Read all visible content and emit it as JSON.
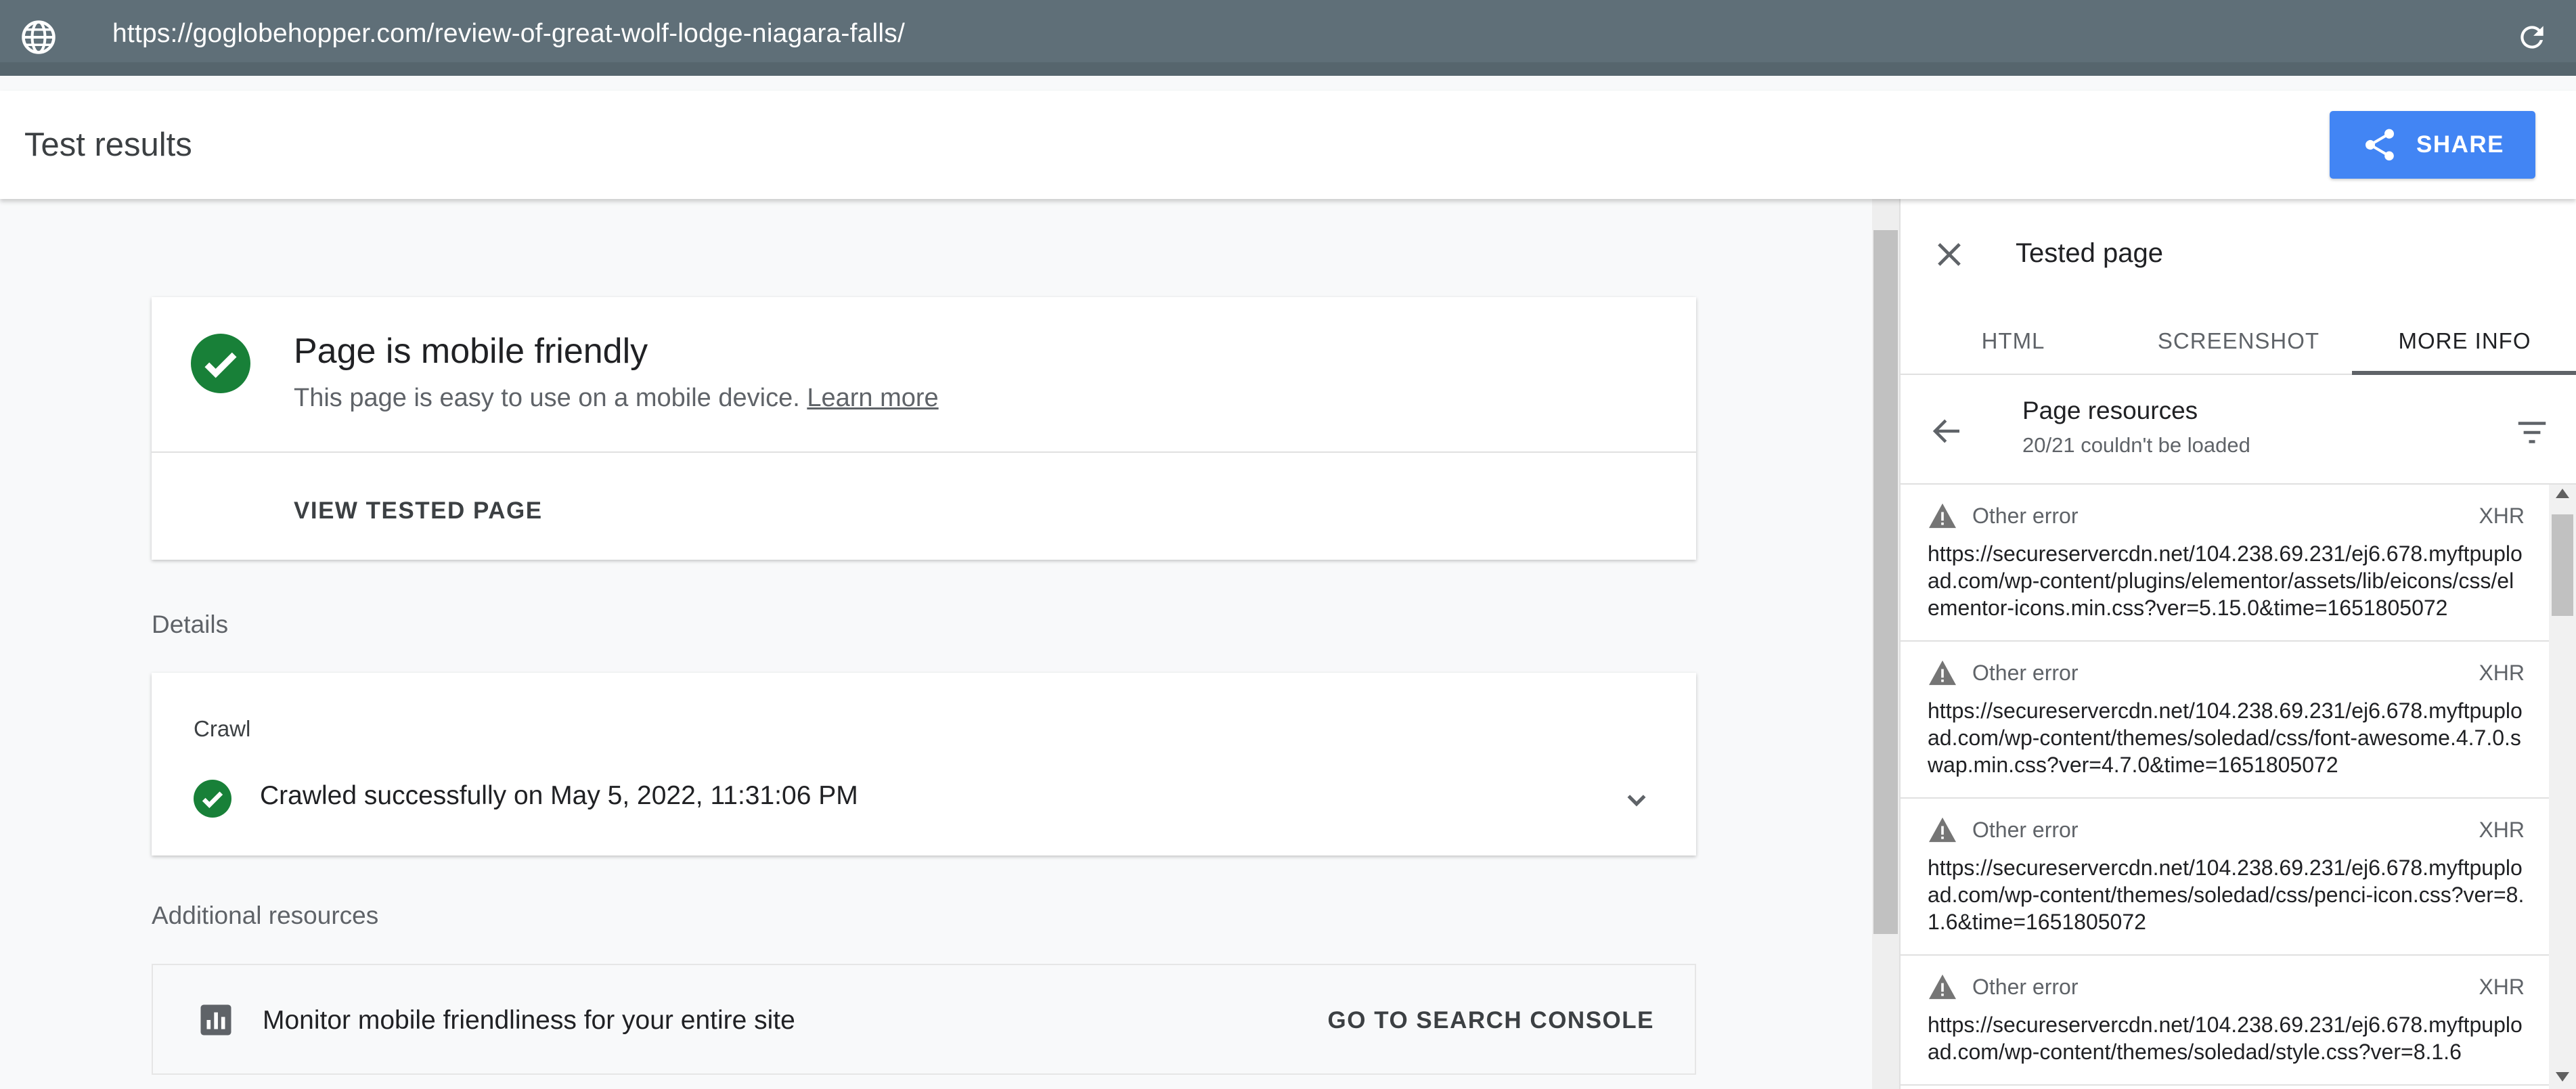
{
  "browser": {
    "url": "https://goglobehopper.com/review-of-great-wolf-lodge-niagara-falls/"
  },
  "header": {
    "title": "Test results",
    "share_label": "SHARE"
  },
  "result": {
    "heading": "Page is mobile friendly",
    "description": "This page is easy to use on a mobile device.",
    "learn_more": "Learn more",
    "view_tested_page": "VIEW TESTED PAGE"
  },
  "details": {
    "label": "Details",
    "crawl_label": "Crawl",
    "crawl_status": "Crawled successfully on May 5, 2022, 11:31:06 PM"
  },
  "additional": {
    "label": "Additional resources",
    "monitor_text": "Monitor mobile friendliness for your entire site",
    "console_button": "GO TO SEARCH CONSOLE"
  },
  "panel": {
    "title": "Tested page",
    "tabs": [
      "HTML",
      "SCREENSHOT",
      "MORE INFO"
    ],
    "active_tab": "MORE INFO",
    "resources_title": "Page resources",
    "resources_subtitle": "20/21 couldn't be loaded",
    "resources": [
      {
        "error": "Other error",
        "type": "XHR",
        "url": "https://secureservercdn.net/104.238.69.231/ej6.678.myftpupload.com/wp-content/plugins/elementor/assets/lib/eicons/css/elementor-icons.min.css?ver=5.15.0&time=1651805072"
      },
      {
        "error": "Other error",
        "type": "XHR",
        "url": "https://secureservercdn.net/104.238.69.231/ej6.678.myftpupload.com/wp-content/themes/soledad/css/font-awesome.4.7.0.swap.min.css?ver=4.7.0&time=1651805072"
      },
      {
        "error": "Other error",
        "type": "XHR",
        "url": "https://secureservercdn.net/104.238.69.231/ej6.678.myftpupload.com/wp-content/themes/soledad/css/penci-icon.css?ver=8.1.6&time=1651805072"
      },
      {
        "error": "Other error",
        "type": "XHR",
        "url": "https://secureservercdn.net/104.238.69.231/ej6.678.myftpupload.com/wp-content/themes/soledad/style.css?ver=8.1.6"
      }
    ]
  },
  "colors": {
    "url_bar": "#5f6f78",
    "accent": "#4285f4",
    "success": "#188038",
    "warning_icon": "#757575"
  }
}
